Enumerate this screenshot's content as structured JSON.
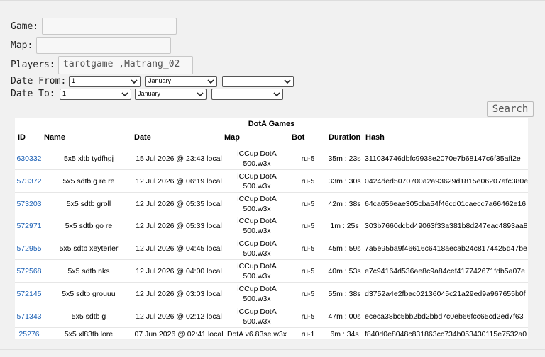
{
  "form": {
    "game_label": "Game:",
    "game_value": "",
    "map_label": "Map:",
    "map_value": "",
    "players_label": "Players:",
    "players_value": "tarotgame ,Matrang_02",
    "date_from_label": "Date From:",
    "date_from_day": "1",
    "date_from_month": "January",
    "date_from_year": "",
    "date_to_label": "Date To:",
    "date_to_day": "1",
    "date_to_month": "January",
    "date_to_year": "",
    "search_label": "Search",
    "chevron_icon": "chevron-down-icon"
  },
  "table": {
    "caption": "DotA Games",
    "headers": {
      "id": "ID",
      "name": "Name",
      "date": "Date",
      "map": "Map",
      "bot": "Bot",
      "duration": "Duration",
      "hash": "Hash"
    },
    "rows": [
      {
        "id": "630332",
        "name": "5x5 xltb tydfhgj",
        "date": "15 Jul 2026 @ 23:43 local",
        "map1": "iCCup DotA",
        "map2": "500.w3x",
        "bot": "ru-5",
        "duration": "35m : 23s",
        "hash": "311034746dbfc9938e2070e7b68147c6f35aff2e"
      },
      {
        "id": "573372",
        "name": "5x5 sdtb g re re",
        "date": "12 Jul 2026 @ 06:19 local",
        "map1": "iCCup DotA",
        "map2": "500.w3x",
        "bot": "ru-5",
        "duration": "33m : 30s",
        "hash": "0424ded5070700a2a93629d1815e06207afc380e"
      },
      {
        "id": "573203",
        "name": "5x5 sdtb groll",
        "date": "12 Jul 2026 @ 05:35 local",
        "map1": "iCCup DotA",
        "map2": "500.w3x",
        "bot": "ru-5",
        "duration": "42m : 38s",
        "hash": "64ca656eae305cba54f46cd01caecc7a66462e16"
      },
      {
        "id": "572971",
        "name": "5x5 sdtb go re",
        "date": "12 Jul 2026 @ 05:33 local",
        "map1": "iCCup DotA",
        "map2": "500.w3x",
        "bot": "ru-5",
        "duration": "1m : 25s",
        "hash": "303b7660dcbd49063f33a381b8d247eac4893aa8"
      },
      {
        "id": "572955",
        "name": "5x5 sdtb xeyterler",
        "date": "12 Jul 2026 @ 04:45 local",
        "map1": "iCCup DotA",
        "map2": "500.w3x",
        "bot": "ru-5",
        "duration": "45m : 59s",
        "hash": "7a5e95ba9f46616c6418aecab24c8174425d47be"
      },
      {
        "id": "572568",
        "name": "5x5 sdtb nks",
        "date": "12 Jul 2026 @ 04:00 local",
        "map1": "iCCup DotA",
        "map2": "500.w3x",
        "bot": "ru-5",
        "duration": "40m : 53s",
        "hash": "e7c94164d536ae8c9a84cef417742671fdb5a07e"
      },
      {
        "id": "572145",
        "name": "5x5 sdtb grouuu",
        "date": "12 Jul 2026 @ 03:03 local",
        "map1": "iCCup DotA",
        "map2": "500.w3x",
        "bot": "ru-5",
        "duration": "55m : 38s",
        "hash": "d3752a4e2fbac02136045c21a29ed9a967655b0f"
      },
      {
        "id": "571343",
        "name": "5x5 sdtb g",
        "date": "12 Jul 2026 @ 02:12 local",
        "map1": "iCCup DotA",
        "map2": "500.w3x",
        "bot": "ru-5",
        "duration": "47m : 00s",
        "hash": "ececa38bc5bb2bd2bbd7c0eb66fcc65cd2ed7f63"
      },
      {
        "id": "25276",
        "name": "5x5 xl83tb lore",
        "date": "07 Jun 2026 @ 02:41 local",
        "map1": "DotA v6.83se.w3x",
        "map2": "",
        "bot": "ru-1",
        "duration": "6m : 34s",
        "hash": "f840d0e8048c831863cc734b053430115e7532a0"
      }
    ]
  },
  "colors": {
    "link": "#1a5fb4",
    "page_bg": "#f1f1f1"
  }
}
